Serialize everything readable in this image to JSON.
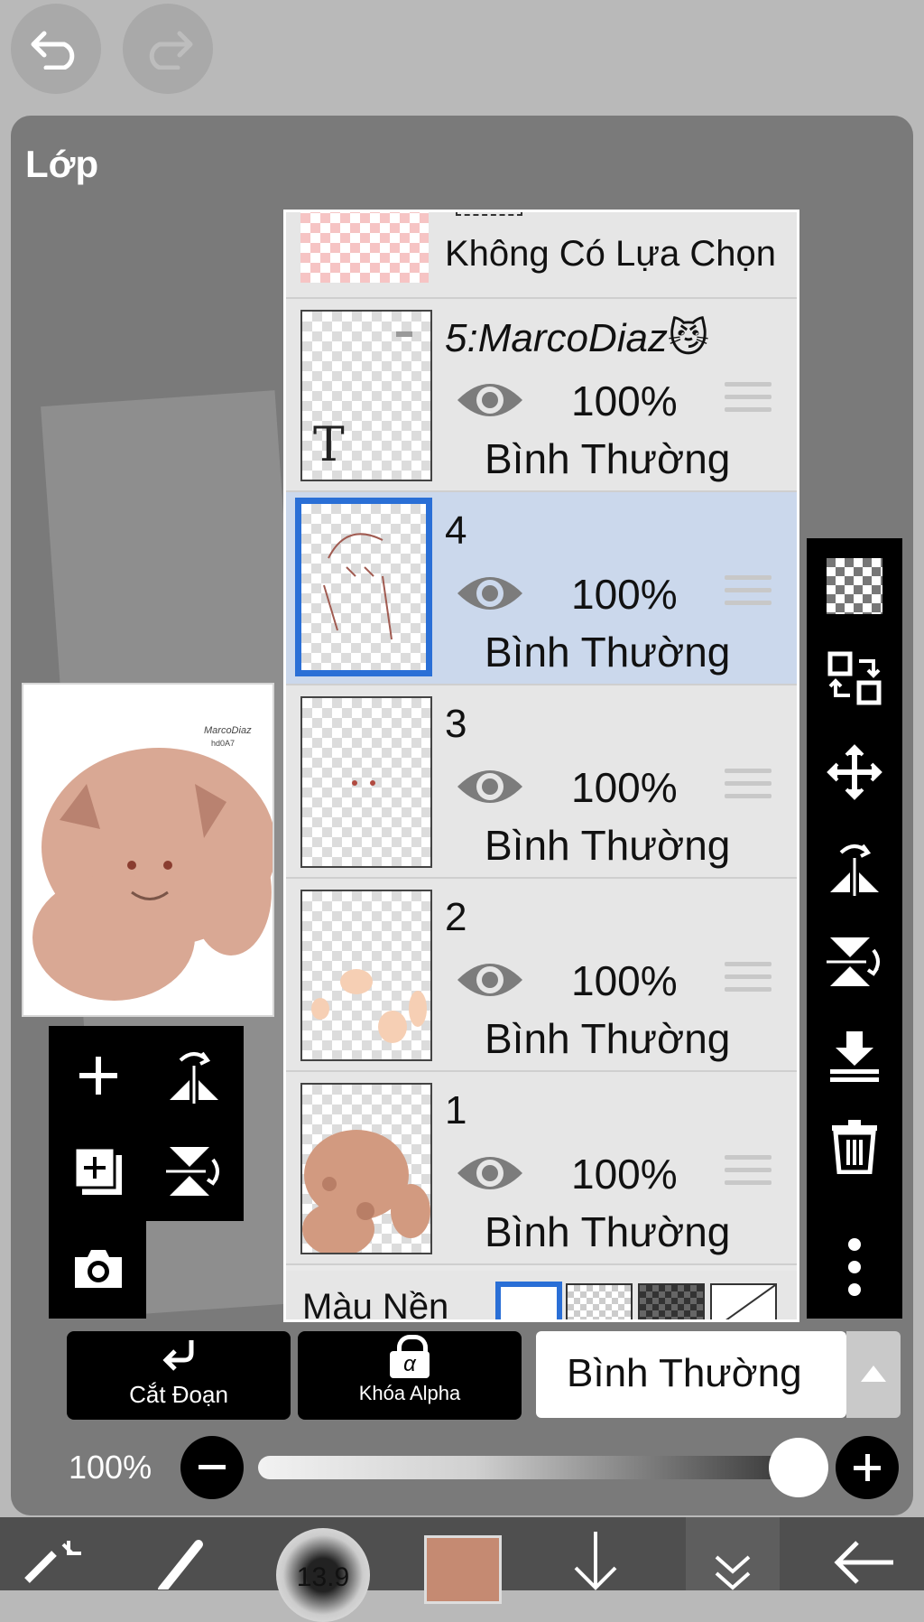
{
  "panel": {
    "title": "Lớp"
  },
  "selection_row": {
    "label": "Không Có Lựa Chọn"
  },
  "layers": [
    {
      "name": "5:MarcoDiaz😼",
      "opacity": "100%",
      "blend": "Bình Thường"
    },
    {
      "name": "4",
      "opacity": "100%",
      "blend": "Bình Thường"
    },
    {
      "name": "3",
      "opacity": "100%",
      "blend": "Bình Thường"
    },
    {
      "name": "2",
      "opacity": "100%",
      "blend": "Bình Thường"
    },
    {
      "name": "1",
      "opacity": "100%",
      "blend": "Bình Thường"
    }
  ],
  "background_row": {
    "label": "Màu Nền"
  },
  "bottom": {
    "clip_label": "Cắt Đoạn",
    "alpha_lock_label": "Khóa Alpha",
    "alpha_symbol": "α",
    "blend_mode": "Bình Thường",
    "opacity_label": "100%",
    "opacity_value": 1.0
  },
  "toolbar": {
    "brush_size": "13.9"
  },
  "colors": {
    "current_color": "#c58a72",
    "selected_border": "#2a6fd6",
    "selected_row": "#cbd8ec"
  },
  "icons": {
    "right_bar": [
      "checker-icon",
      "swap-layers-icon",
      "move-icon",
      "flip-horizontal-icon",
      "flip-vertical-icon",
      "merge-down-icon",
      "trash-icon",
      "more-vertical-icon"
    ],
    "left_bar": [
      "add-layer-icon",
      "flip-horizontal-icon",
      "duplicate-layer-icon",
      "flip-vertical-icon",
      "camera-icon"
    ]
  }
}
